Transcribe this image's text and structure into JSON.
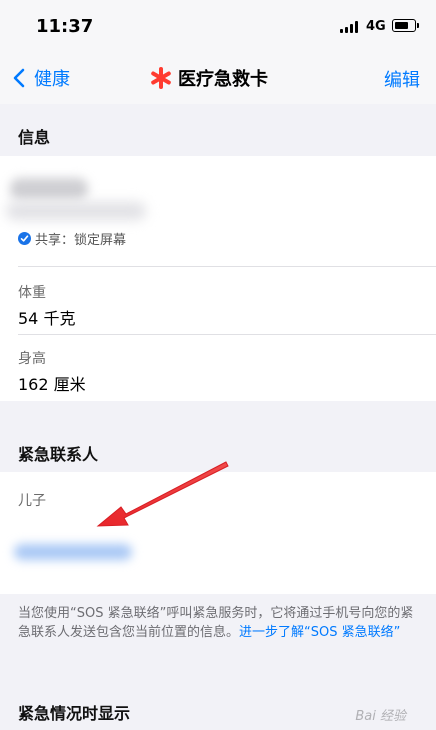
{
  "status_bar": {
    "time": "11:37",
    "network": "4G"
  },
  "nav": {
    "back_label": "健康",
    "title": "医疗急救卡",
    "edit_label": "编辑",
    "accent_color": "#007aff",
    "title_icon": "red-asterisk-icon"
  },
  "info_section": {
    "header": "信息",
    "share_text": "共享：锁定屏幕",
    "fields": [
      {
        "label": "体重",
        "value": "54 千克"
      },
      {
        "label": "身高",
        "value": "162 厘米"
      }
    ]
  },
  "emergency_contacts": {
    "header": "紧急联系人",
    "relation": "儿子",
    "footnote": "当您使用“SOS 紧急联络”呼叫紧急服务时，它将通过手机号向您的紧急联系人发送包含您当前位置的信息。",
    "footnote_link": "进一步了解“SOS 紧急联络”"
  },
  "display_section": {
    "header": "紧急情况时显示"
  },
  "watermark": "Bai 经验"
}
